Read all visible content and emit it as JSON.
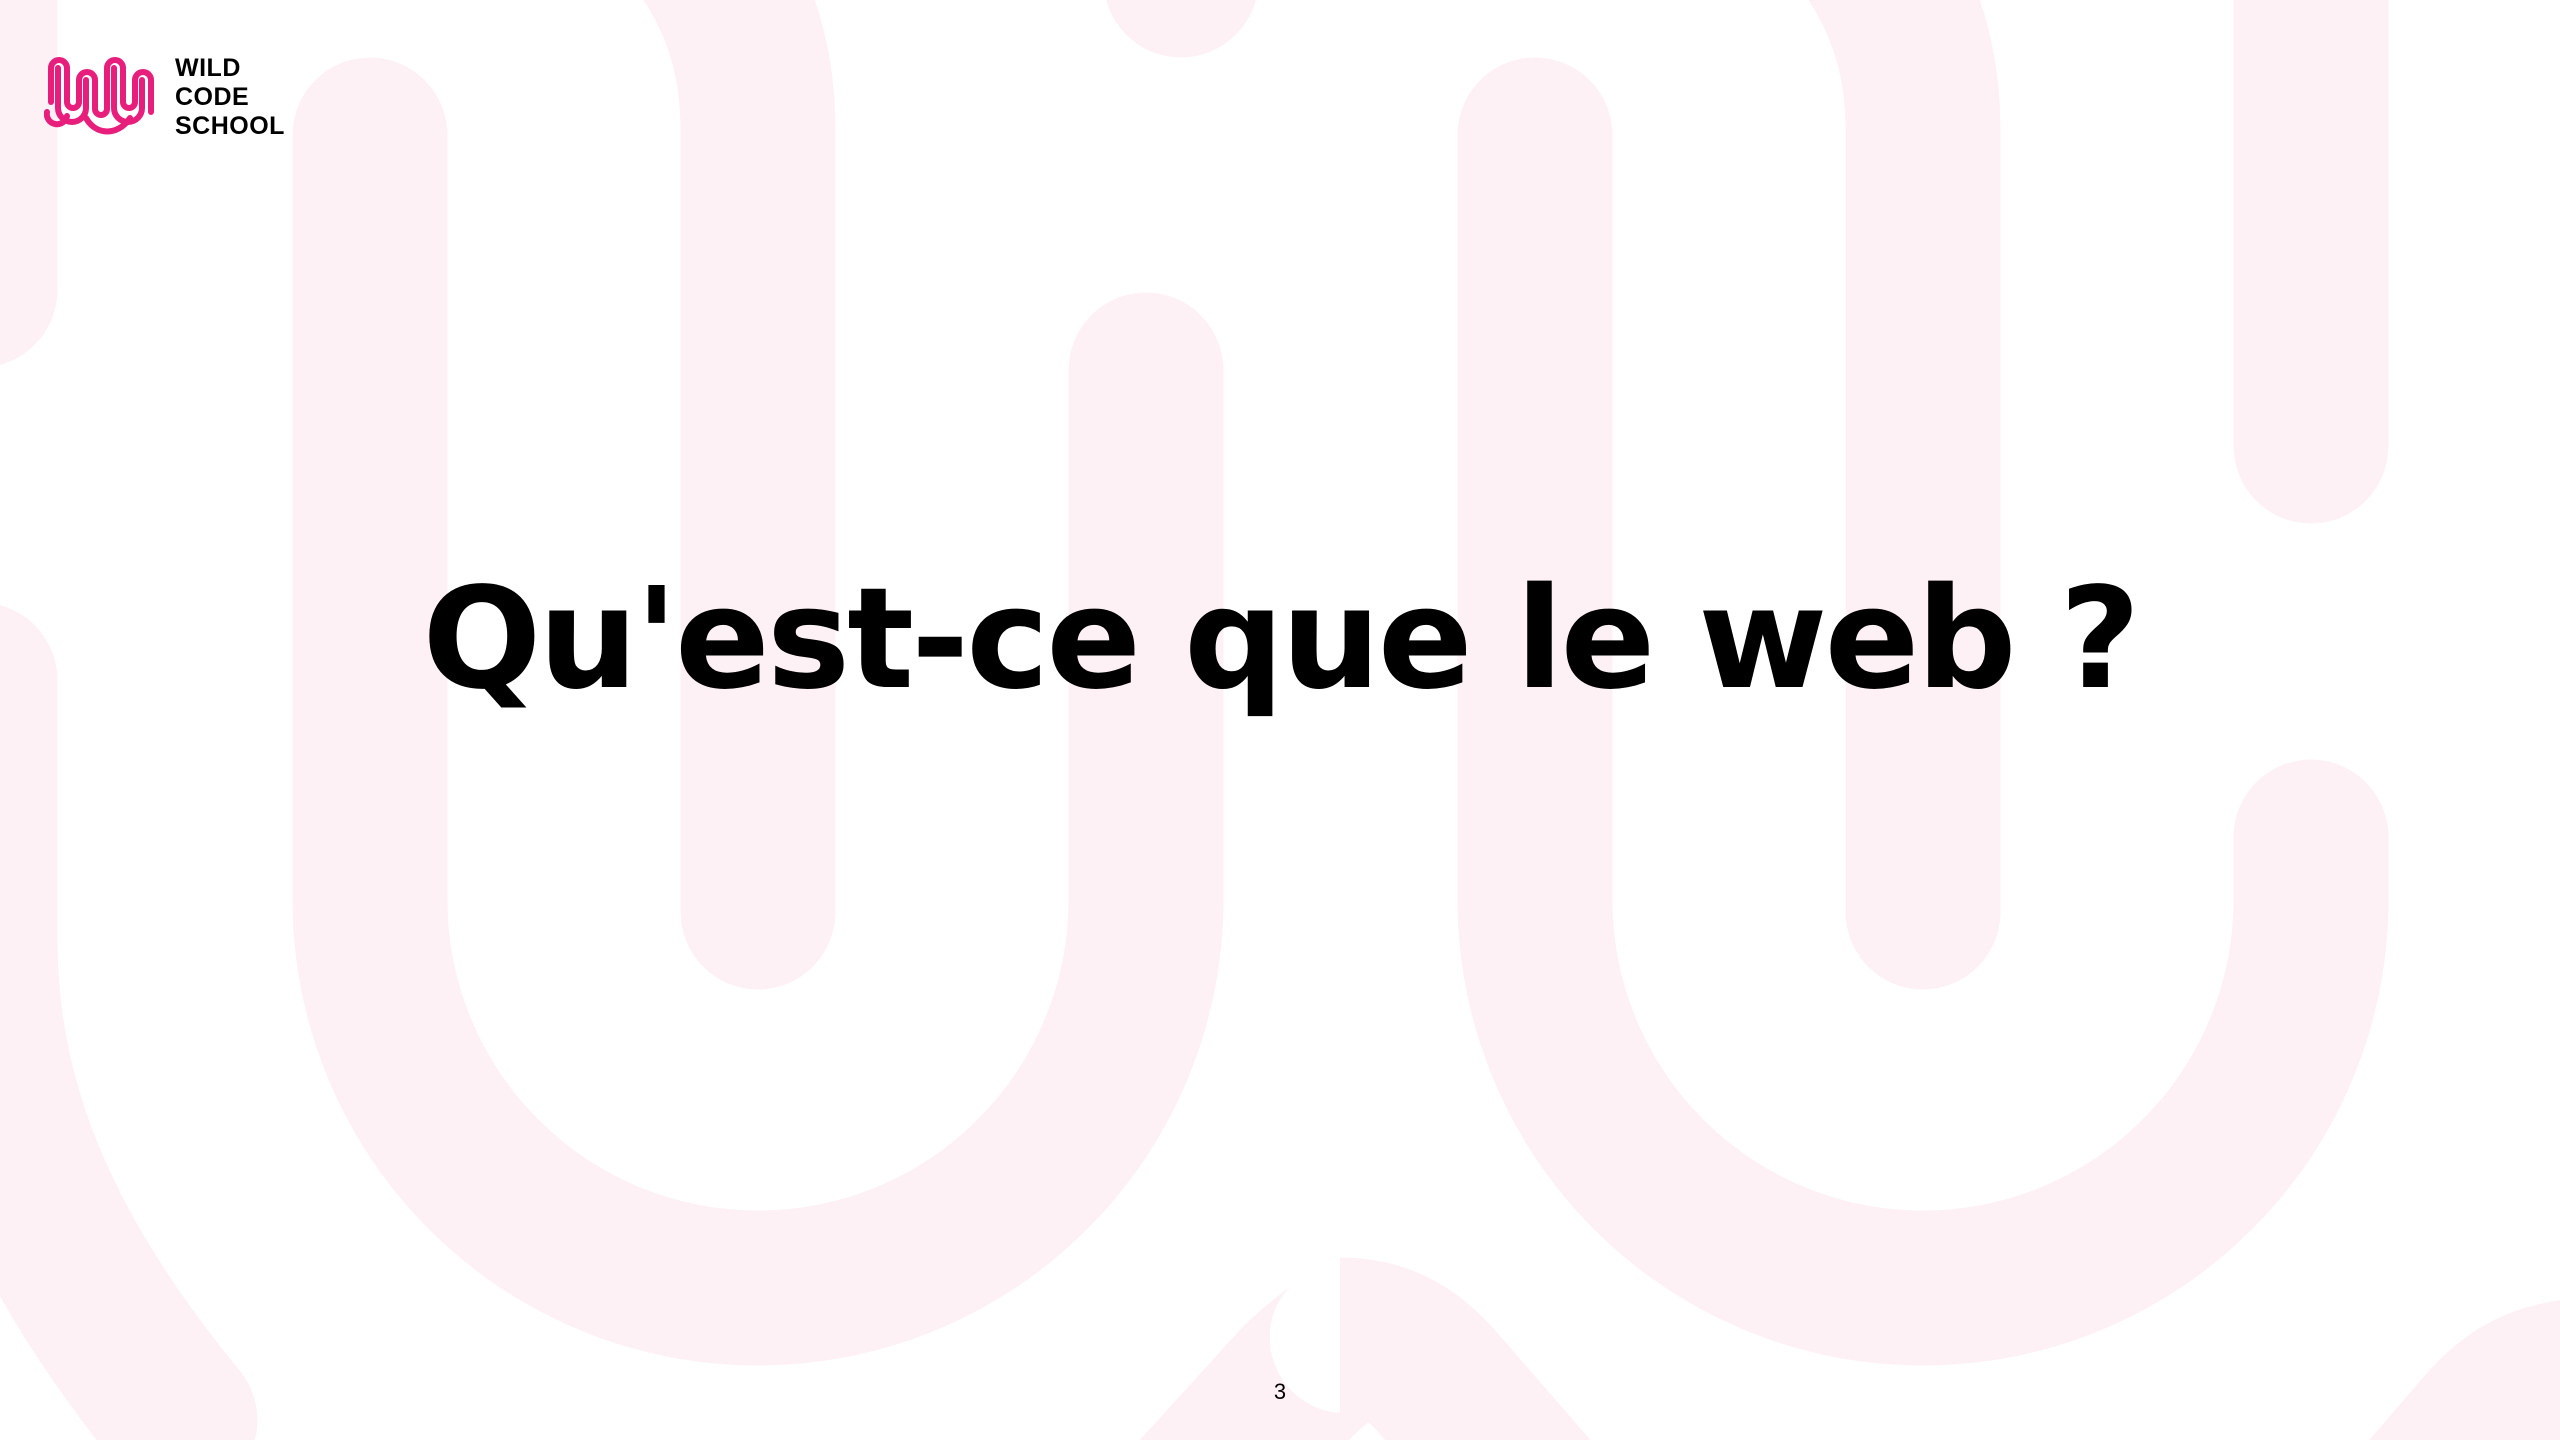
{
  "slide": {
    "title": "Qu'est-ce que le web ?",
    "page_number": "3"
  },
  "logo": {
    "line1": "WILD",
    "line2": "CODE",
    "line3": "SCHOOL",
    "icon": "wild-code-school-logo-icon"
  },
  "colors": {
    "brand_pink": "#e81e7c",
    "background_pattern": "#fdf1f5",
    "text": "#000000",
    "background": "#ffffff"
  }
}
